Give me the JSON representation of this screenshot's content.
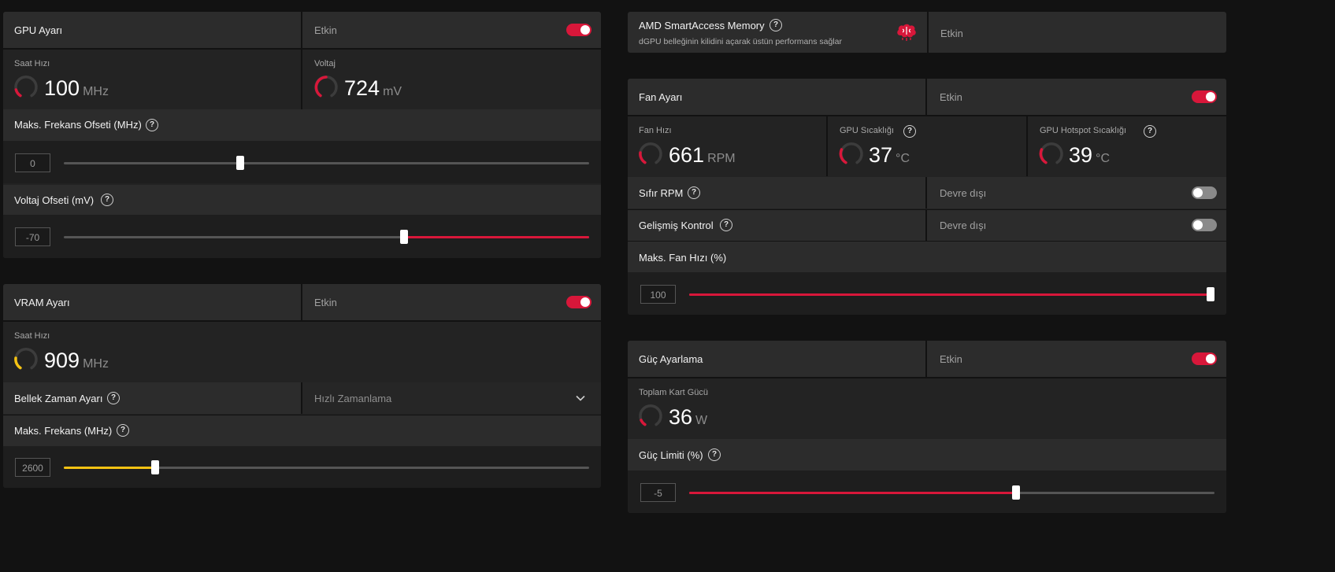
{
  "colors": {
    "accent_red": "#d8173a",
    "accent_yellow": "#f5c313",
    "background": "#121212"
  },
  "gpu": {
    "title": "GPU Ayarı",
    "status": "Etkin",
    "toggle_on": true,
    "clock_label": "Saat Hızı",
    "clock_value": "100",
    "clock_unit": "MHz",
    "voltage_label": "Voltaj",
    "voltage_value": "724",
    "voltage_unit": "mV",
    "max_freq_offset_label": "Maks. Frekans Ofseti (MHz)",
    "max_freq_offset_value": "0",
    "max_freq_offset_slider": 0.34,
    "voltage_offset_label": "Voltaj Ofseti (mV)",
    "voltage_offset_value": "-70",
    "voltage_offset_slider": 0.65
  },
  "vram": {
    "title": "VRAM Ayarı",
    "status": "Etkin",
    "toggle_on": true,
    "clock_label": "Saat Hızı",
    "clock_value": "909",
    "clock_unit": "MHz",
    "timing_label": "Bellek Zaman Ayarı",
    "timing_value": "Hızlı Zamanlama",
    "max_freq_label": "Maks. Frekans (MHz)",
    "max_freq_value": "2600",
    "max_freq_slider": 0.175
  },
  "sam": {
    "title": "AMD SmartAccess Memory",
    "description": "dGPU belleğinin kilidini açarak üstün performans sağlar",
    "status": "Etkin",
    "icon": "brain-icon"
  },
  "fan": {
    "title": "Fan Ayarı",
    "status": "Etkin",
    "toggle_on": true,
    "speed_label": "Fan Hızı",
    "speed_value": "661",
    "speed_unit": "RPM",
    "temp_label": "GPU Sıcaklığı",
    "temp_value": "37",
    "temp_unit": "°C",
    "hotspot_label": "GPU Hotspot Sıcaklığı",
    "hotspot_value": "39",
    "hotspot_unit": "°C",
    "zero_rpm_label": "Sıfır RPM",
    "zero_rpm_status": "Devre dışı",
    "zero_rpm_on": false,
    "advanced_label": "Gelişmiş Kontrol",
    "advanced_status": "Devre dışı",
    "advanced_on": false,
    "max_speed_label": "Maks. Fan Hızı (%)",
    "max_speed_value": "100",
    "max_speed_slider": 1.0
  },
  "power": {
    "title": "Güç Ayarlama",
    "status": "Etkin",
    "toggle_on": true,
    "total_label": "Toplam Kart Gücü",
    "total_value": "36",
    "total_unit": "W",
    "limit_label": "Güç Limiti (%)",
    "limit_value": "-5",
    "limit_slider": 0.62
  }
}
